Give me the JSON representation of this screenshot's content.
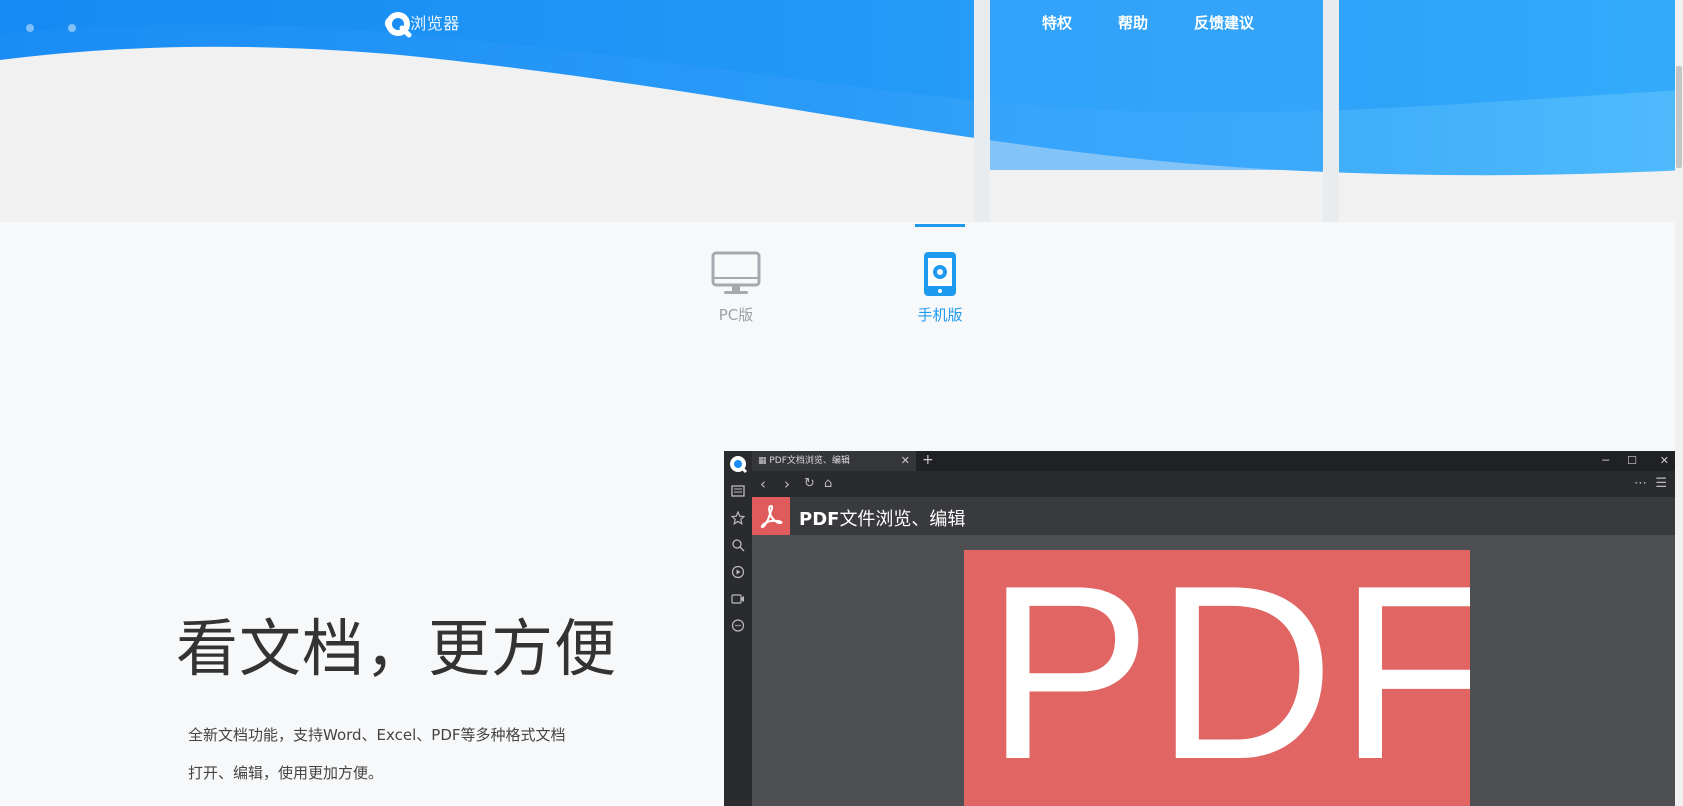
{
  "header": {
    "logo_text": "QQ浏览器",
    "nav": [
      "特权",
      "帮助",
      "反馈建议"
    ]
  },
  "tabs": {
    "pc_label": "PC版",
    "mobile_label": "手机版",
    "active": "mobile"
  },
  "feature": {
    "headline": "看文档，更方便",
    "description_line1": "全新文档功能，支持Word、Excel、PDF等多种格式文档",
    "description_line2": "打开、编辑，使用更加方便。"
  },
  "screenshot": {
    "tab_title": "PDF文档浏览、编辑",
    "header_prefix": "PDF",
    "header_suffix": "文件浏览、编辑",
    "page_text": "PDF"
  },
  "colors": {
    "brand_blue": "#1e9bf0",
    "pdf_red": "#e06563"
  }
}
